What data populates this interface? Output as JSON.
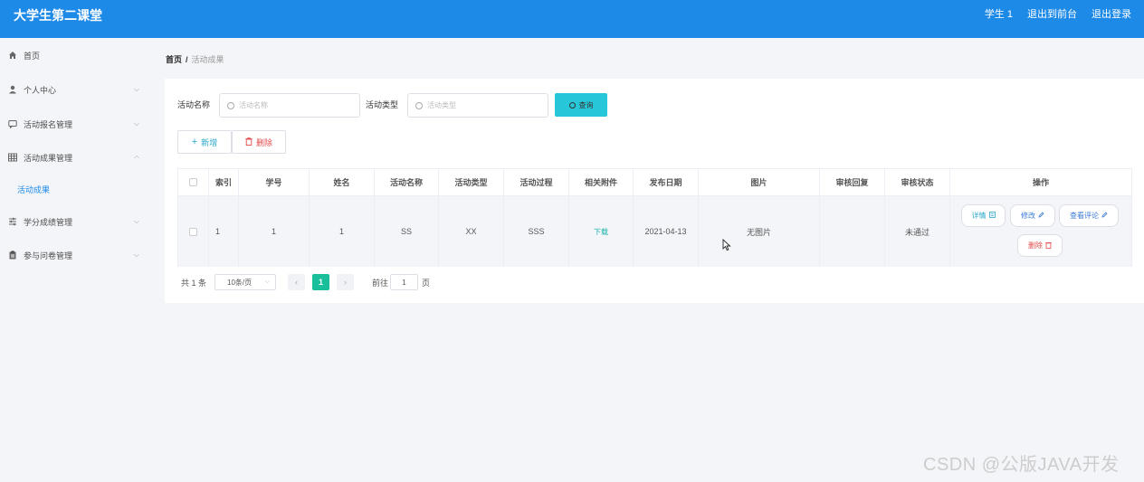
{
  "header": {
    "app_title": "大学生第二课堂",
    "user_label": "学生 1",
    "exit_front_label": "退出到前台",
    "logout_label": "退出登录",
    "color": "#1e8ae8"
  },
  "sidebar": {
    "items": [
      {
        "label": "首页",
        "icon": "home-icon"
      },
      {
        "label": "个人中心",
        "icon": "user-icon"
      },
      {
        "label": "活动报名管理",
        "icon": "chat-icon"
      },
      {
        "label": "活动成果管理",
        "icon": "grid-icon"
      },
      {
        "label": "学分成绩管理",
        "icon": "sliders-icon"
      },
      {
        "label": "参与问卷管理",
        "icon": "clipboard-icon"
      }
    ],
    "sub_item": "活动成果"
  },
  "breadcrumb": {
    "home": "首页",
    "separator": "/",
    "current": "活动成果"
  },
  "search": {
    "name_label": "活动名称",
    "name_placeholder": "活动名称",
    "type_label": "活动类型",
    "type_placeholder": "活动类型",
    "query_label": "查询"
  },
  "actions": {
    "add_label": "新增",
    "delete_label": "删除"
  },
  "table": {
    "headers": [
      "索引",
      "学号",
      "姓名",
      "活动名称",
      "活动类型",
      "活动过程",
      "相关附件",
      "发布日期",
      "图片",
      "审核回复",
      "审核状态",
      "操作"
    ],
    "rows": [
      {
        "index": "1",
        "student_id": "1",
        "name": "1",
        "activity_name": "SS",
        "activity_type": "XX",
        "process": "SSS",
        "attachment": "下载",
        "date": "2021-04-13",
        "image": "无图片",
        "reply": "",
        "status": "未通过",
        "ops": {
          "detail": "详情",
          "edit": "修改",
          "review": "查看评论",
          "delete": "删除"
        }
      }
    ]
  },
  "pagination": {
    "total": "共 1 条",
    "page_size": "10条/页",
    "current_page": "1",
    "goto_label": "前往",
    "goto_value": "1",
    "page_suffix": "页"
  },
  "watermark": "CSDN @公版JAVA开发"
}
